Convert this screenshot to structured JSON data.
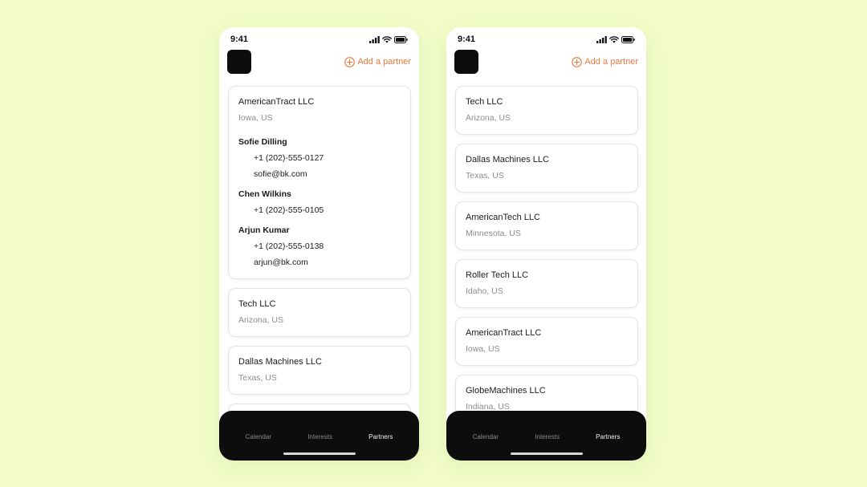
{
  "colors": {
    "background": "#f1fcc8",
    "accent": "#e77a3e",
    "tabbar": "#0d0d0d"
  },
  "screens": [
    {
      "status": {
        "time": "9:41",
        "icons": [
          "signal-icon",
          "wifi-icon",
          "battery-icon"
        ]
      },
      "header": {
        "add_label": "Add a partner",
        "add_icon": "plus-circle-icon"
      },
      "expanded": {
        "name": "AmericanTract LLC",
        "location": "Iowa, US",
        "contacts": [
          {
            "name": "Sofie Dilling",
            "phone": "+1 (202)-555-0127",
            "email": "sofie@bk.com"
          },
          {
            "name": "Chen Wilkins",
            "phone": "+1 (202)-555-0105",
            "email": ""
          },
          {
            "name": "Arjun Kumar",
            "phone": "+1 (202)-555-0138",
            "email": "arjun@bk.com"
          }
        ]
      },
      "partners": [
        {
          "name": "Tech LLC",
          "location": "Arizona, US"
        },
        {
          "name": "Dallas Machines LLC",
          "location": "Texas, US"
        }
      ],
      "tabs": {
        "calendar": "Calendar",
        "interests": "Interests",
        "partners": "Partners"
      },
      "active_tab": "Partners"
    },
    {
      "status": {
        "time": "9:41",
        "icons": [
          "signal-icon",
          "wifi-icon",
          "battery-icon"
        ]
      },
      "header": {
        "add_label": "Add a partner",
        "add_icon": "plus-circle-icon"
      },
      "partners": [
        {
          "name": "Tech LLC",
          "location": "Arizona, US"
        },
        {
          "name": "Dallas Machines LLC",
          "location": "Texas, US"
        },
        {
          "name": "AmericanTech LLC",
          "location": "Minnesota, US"
        },
        {
          "name": "Roller Tech LLC",
          "location": "Idaho, US"
        },
        {
          "name": "AmericanTract LLC",
          "location": "Iowa, US"
        },
        {
          "name": "GlobeMachines LLC",
          "location": "Indiana, US"
        }
      ],
      "tabs": {
        "calendar": "Calendar",
        "interests": "Interests",
        "partners": "Partners"
      },
      "active_tab": "Partners"
    }
  ]
}
